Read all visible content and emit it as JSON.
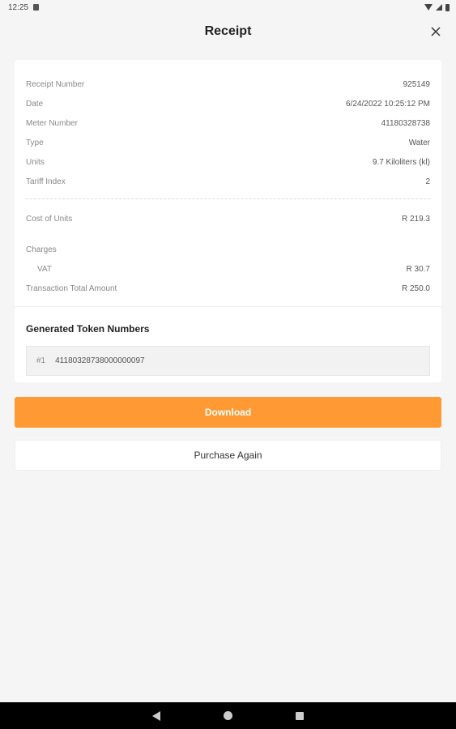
{
  "status_bar": {
    "time": "12:25",
    "icons": [
      "sd-card-icon",
      "wifi-icon",
      "signal-icon",
      "battery-icon"
    ]
  },
  "header": {
    "title": "Receipt",
    "close_icon": "close-icon"
  },
  "receipt": {
    "rows": [
      {
        "label": "Receipt Number",
        "value": "925149"
      },
      {
        "label": "Date",
        "value": "6/24/2022 10:25:12 PM"
      },
      {
        "label": "Meter Number",
        "value": "41180328738"
      },
      {
        "label": "Type",
        "value": "Water"
      },
      {
        "label": "Units",
        "value": "9.7 Kiloliters (kl)"
      },
      {
        "label": "Tariff Index",
        "value": "2"
      }
    ],
    "cost": {
      "label": "Cost of Units",
      "value": "R 219.3"
    },
    "charges_label": "Charges",
    "vat": {
      "label": "VAT",
      "value": "R 30.7"
    },
    "total": {
      "label": "Transaction Total Amount",
      "value": "R 250.0"
    }
  },
  "tokens": {
    "title": "Generated Token Numbers",
    "items": [
      {
        "index": "#1",
        "number": "41180328738000000097"
      }
    ]
  },
  "actions": {
    "download_label": "Download",
    "purchase_again_label": "Purchase Again"
  },
  "colors": {
    "accent": "#ff9933",
    "background": "#f5f5f5"
  }
}
